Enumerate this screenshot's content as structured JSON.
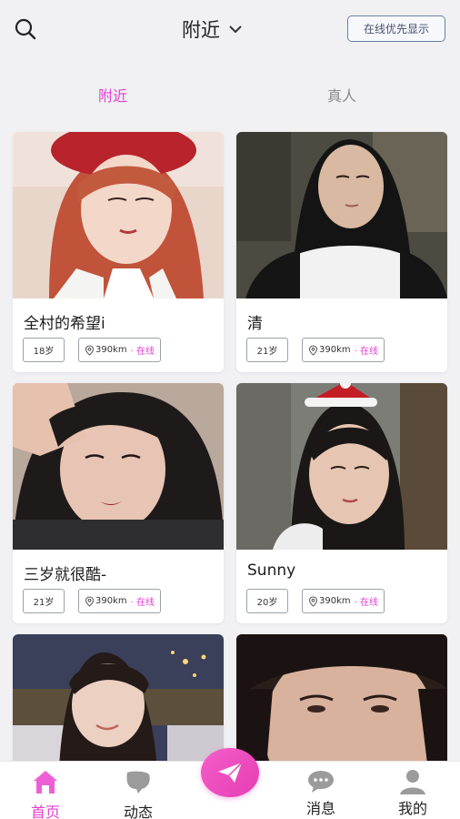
{
  "header": {
    "search_icon": "search-icon",
    "location_label": "附近",
    "location_icon": "chevron-down-icon",
    "online_first_label": "在线优先显示"
  },
  "tabs": [
    {
      "label": "附近",
      "active": true
    },
    {
      "label": "真人",
      "active": false
    }
  ],
  "colors": {
    "accent": "#e23fd0",
    "background": "#f1f1f3",
    "card": "#ffffff"
  },
  "cards": [
    {
      "name": "全村的希望i",
      "age": "18岁",
      "distance": "390km",
      "status": "· 在线"
    },
    {
      "name": "清",
      "age": "21岁",
      "distance": "390km",
      "status": "· 在线"
    },
    {
      "name": "三岁就很酷-",
      "age": "21岁",
      "distance": "390km",
      "status": "· 在线"
    },
    {
      "name": "Sunny",
      "age": "20岁",
      "distance": "390km",
      "status": "· 在线"
    },
    {
      "name": "",
      "age": "",
      "distance": "",
      "status": ""
    },
    {
      "name": "",
      "age": "",
      "distance": "",
      "status": ""
    }
  ],
  "bottom_nav": {
    "home": {
      "label": "首页",
      "icon": "home-icon"
    },
    "feed": {
      "label": "动态",
      "icon": "moments-icon"
    },
    "publish": {
      "icon": "paper-plane-icon"
    },
    "messages": {
      "label": "消息",
      "icon": "chat-bubble-icon"
    },
    "me": {
      "label": "我的",
      "icon": "user-icon"
    }
  }
}
